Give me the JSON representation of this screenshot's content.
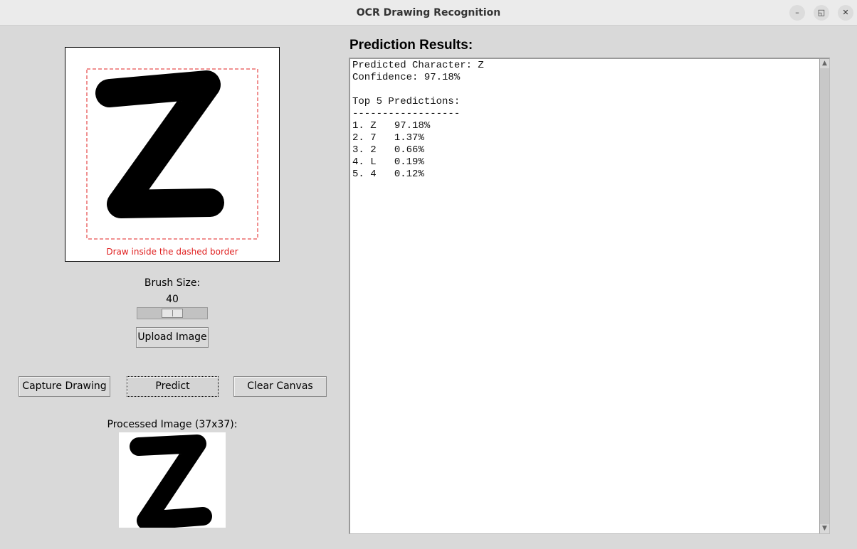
{
  "window": {
    "title": "OCR Drawing Recognition",
    "minimize_glyph": "–",
    "maximize_glyph": "◱",
    "close_glyph": "✕"
  },
  "canvas": {
    "drawn_character": "Z",
    "hint": "Draw inside the dashed border",
    "hint_color": "#e02020"
  },
  "brush": {
    "label": "Brush Size:",
    "value": "40",
    "slider_fraction": 0.44
  },
  "buttons": {
    "upload": "Upload Image",
    "capture": "Capture Drawing",
    "predict": "Predict",
    "clear": "Clear Canvas"
  },
  "processed": {
    "label": "Processed Image (37x37):"
  },
  "results": {
    "heading": "Prediction Results:",
    "predicted_line": "Predicted Character: Z",
    "confidence_line": "Confidence: 97.18%",
    "top5_title": "Top 5 Predictions:",
    "separator": "------------------",
    "predictions": [
      {
        "rank": "1.",
        "char": "Z",
        "prob": "97.18%"
      },
      {
        "rank": "2.",
        "char": "7",
        "prob": "1.37%"
      },
      {
        "rank": "3.",
        "char": "2",
        "prob": "0.66%"
      },
      {
        "rank": "4.",
        "char": "L",
        "prob": "0.19%"
      },
      {
        "rank": "5.",
        "char": "4",
        "prob": "0.12%"
      }
    ]
  }
}
